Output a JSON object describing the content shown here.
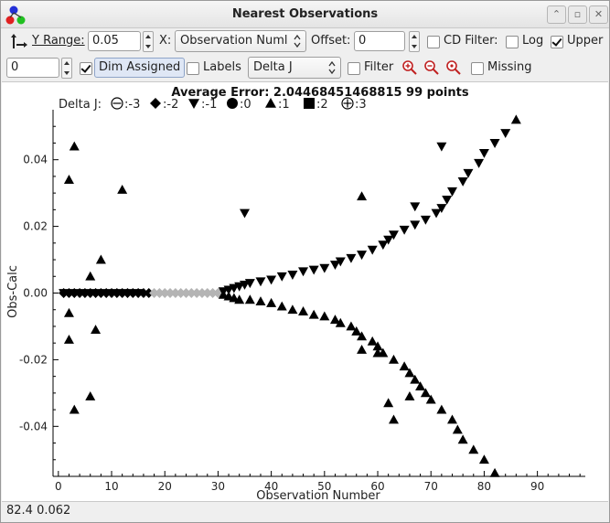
{
  "window": {
    "title": "Nearest Observations",
    "buttons": [
      "up-arrow",
      "restore",
      "close"
    ]
  },
  "toolbar1": {
    "y_range_label": "Y Range:",
    "y_range_value": "0.05",
    "x_label": "X:",
    "x_selected": "Observation Numl",
    "offset_label": "Offset:",
    "offset_value": "0",
    "cd_filter_label": "CD Filter:",
    "cd_filter_checked": false,
    "log_label": "Log",
    "log_checked": false,
    "upper_label": "Upper",
    "upper_checked": true
  },
  "toolbar2": {
    "spin_value": "0",
    "dim_assigned_checked": true,
    "dim_assigned_label": "Dim Assigned",
    "labels_label": "Labels",
    "labels_checked": false,
    "delta_selected": "Delta J",
    "filter_label": "Filter",
    "filter_checked": false,
    "missing_label": "Missing",
    "missing_checked": false
  },
  "status_bar": "82.4  0.062",
  "colors": {
    "assigned": "#000000",
    "dimmed": "#b4b4b4"
  },
  "chart_data": {
    "type": "scatter",
    "title": "Average Error: 2.04468451468815  99 points",
    "xlabel": "Observation Number",
    "ylabel": "Obs-Calc",
    "xlim": [
      -1,
      99
    ],
    "ylim": [
      -0.055,
      0.055
    ],
    "xticks": [
      0,
      10,
      20,
      30,
      40,
      50,
      60,
      70,
      80,
      90
    ],
    "yticks": [
      -0.04,
      -0.02,
      0.0,
      0.02,
      0.04
    ],
    "ytick_labels": [
      "-0.04",
      "-0.02",
      "0.00",
      "0.02",
      "0.04"
    ],
    "legend": {
      "title": "Delta J:",
      "entries": [
        {
          "symbol": "circle-minus",
          "label": ":-3"
        },
        {
          "symbol": "diamond",
          "label": ":-2"
        },
        {
          "symbol": "triangle-down",
          "label": ":-1"
        },
        {
          "symbol": "circle",
          "label": ":0"
        },
        {
          "symbol": "triangle-up",
          "label": ":1"
        },
        {
          "symbol": "square",
          "label": ":2"
        },
        {
          "symbol": "circle-plus",
          "label": ":3"
        }
      ]
    },
    "series": [
      {
        "name": "-2",
        "symbol": "diamond",
        "points": [
          [
            1,
            0.0
          ],
          [
            2,
            0.0
          ],
          [
            3,
            0.0
          ],
          [
            4,
            0.0
          ],
          [
            5,
            0.0
          ],
          [
            6,
            0.0
          ],
          [
            7,
            0.0
          ],
          [
            8,
            0.0
          ],
          [
            9,
            0.0
          ],
          [
            10,
            0.0
          ],
          [
            11,
            0.0
          ],
          [
            12,
            0.0
          ],
          [
            13,
            0.0
          ],
          [
            14,
            0.0
          ],
          [
            15,
            0.0
          ],
          [
            16,
            0.0
          ],
          [
            17,
            0.0
          ]
        ]
      },
      {
        "name": "-2 (dimmed)",
        "symbol": "diamond",
        "dimmed": true,
        "points": [
          [
            18,
            0.0
          ],
          [
            19,
            0.0
          ],
          [
            20,
            0.0
          ],
          [
            21,
            0.0
          ],
          [
            22,
            0.0
          ],
          [
            23,
            0.0
          ],
          [
            24,
            0.0
          ],
          [
            25,
            0.0
          ],
          [
            26,
            0.0
          ],
          [
            27,
            0.0
          ],
          [
            28,
            0.0
          ],
          [
            29,
            0.0
          ],
          [
            30,
            0.0
          ]
        ]
      },
      {
        "name": "-1",
        "symbol": "triangle-down",
        "points": [
          [
            1,
            0.0
          ],
          [
            3,
            0.0
          ],
          [
            5,
            0.0
          ],
          [
            7,
            0.0
          ],
          [
            9,
            0.0
          ],
          [
            11,
            0.0
          ],
          [
            13,
            0.0
          ],
          [
            15,
            0.0
          ],
          [
            31,
            0.0005
          ],
          [
            32,
            0.001
          ],
          [
            33,
            0.0015
          ],
          [
            34,
            0.002
          ],
          [
            35,
            0.0025
          ],
          [
            36,
            0.003
          ],
          [
            38,
            0.0035
          ],
          [
            40,
            0.004
          ],
          [
            42,
            0.005
          ],
          [
            44,
            0.0055
          ],
          [
            46,
            0.0065
          ],
          [
            48,
            0.007
          ],
          [
            50,
            0.0075
          ],
          [
            52,
            0.0085
          ],
          [
            53,
            0.0095
          ],
          [
            55,
            0.0105
          ],
          [
            57,
            0.0115
          ],
          [
            59,
            0.013
          ],
          [
            61,
            0.0145
          ],
          [
            62,
            0.016
          ],
          [
            63,
            0.0175
          ],
          [
            65,
            0.019
          ],
          [
            67,
            0.0205
          ],
          [
            69,
            0.022
          ],
          [
            71,
            0.024
          ],
          [
            72,
            0.0255
          ],
          [
            73,
            0.028
          ],
          [
            74,
            0.0305
          ],
          [
            76,
            0.0335
          ],
          [
            77,
            0.036
          ],
          [
            79,
            0.039
          ],
          [
            80,
            0.042
          ],
          [
            82,
            0.045
          ],
          [
            84,
            0.048
          ],
          [
            35,
            0.024
          ],
          [
            67,
            0.026
          ],
          [
            72,
            0.044
          ]
        ]
      },
      {
        "name": "1",
        "symbol": "triangle-up",
        "points": [
          [
            2,
            0.034
          ],
          [
            3,
            0.044
          ],
          [
            2,
            -0.006
          ],
          [
            2,
            -0.014
          ],
          [
            3,
            -0.035
          ],
          [
            6,
            0.005
          ],
          [
            6,
            -0.031
          ],
          [
            7,
            -0.011
          ],
          [
            8,
            0.01
          ],
          [
            12,
            0.031
          ],
          [
            31,
            -0.0005
          ],
          [
            32,
            -0.001
          ],
          [
            33,
            -0.0015
          ],
          [
            34,
            -0.002
          ],
          [
            36,
            -0.002
          ],
          [
            38,
            -0.0025
          ],
          [
            40,
            -0.003
          ],
          [
            42,
            -0.004
          ],
          [
            44,
            -0.005
          ],
          [
            46,
            -0.0055
          ],
          [
            48,
            -0.0065
          ],
          [
            50,
            -0.007
          ],
          [
            52,
            -0.008
          ],
          [
            53,
            -0.009
          ],
          [
            55,
            -0.01
          ],
          [
            56,
            -0.0115
          ],
          [
            57,
            -0.013
          ],
          [
            59,
            -0.0145
          ],
          [
            60,
            -0.016
          ],
          [
            61,
            -0.018
          ],
          [
            63,
            -0.02
          ],
          [
            65,
            -0.022
          ],
          [
            66,
            -0.024
          ],
          [
            67,
            -0.026
          ],
          [
            68,
            -0.028
          ],
          [
            69,
            -0.03
          ],
          [
            70,
            -0.032
          ],
          [
            72,
            -0.035
          ],
          [
            74,
            -0.038
          ],
          [
            75,
            -0.041
          ],
          [
            76,
            -0.044
          ],
          [
            78,
            -0.047
          ],
          [
            80,
            -0.05
          ],
          [
            82,
            -0.054
          ],
          [
            57,
            -0.017
          ],
          [
            60,
            -0.018
          ],
          [
            62,
            -0.033
          ],
          [
            63,
            -0.038
          ],
          [
            66,
            -0.031
          ],
          [
            57,
            0.029
          ],
          [
            86,
            0.052
          ]
        ]
      }
    ]
  }
}
